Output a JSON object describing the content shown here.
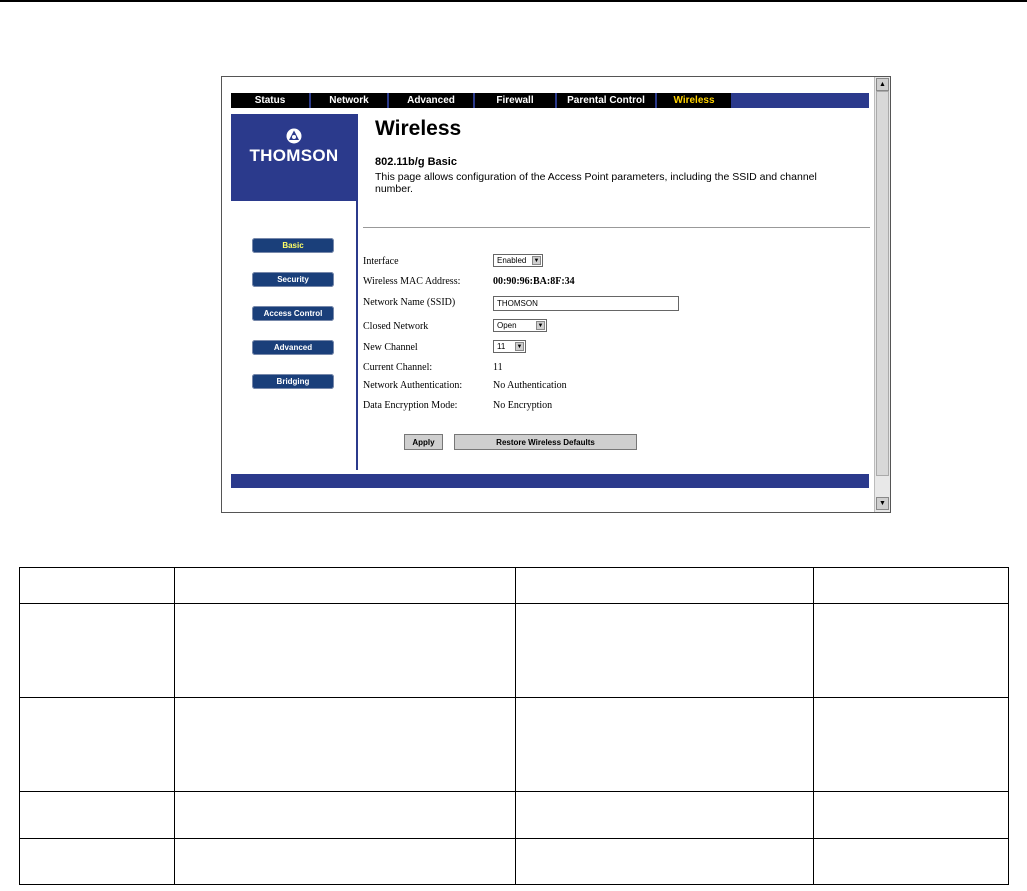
{
  "nav": {
    "tabs": [
      {
        "label": "Status"
      },
      {
        "label": "Network"
      },
      {
        "label": "Advanced"
      },
      {
        "label": "Firewall"
      },
      {
        "label": "Parental Control"
      },
      {
        "label": "Wireless"
      }
    ],
    "active": "Wireless"
  },
  "logo": {
    "text": "THOMSON"
  },
  "sidebar": {
    "buttons": [
      {
        "label": "Basic"
      },
      {
        "label": "Security"
      },
      {
        "label": "Access Control"
      },
      {
        "label": "Advanced"
      },
      {
        "label": "Bridging"
      }
    ],
    "active": "Basic"
  },
  "page": {
    "title": "Wireless",
    "subtitle": "802.11b/g Basic",
    "description": "This page allows configuration of the Access Point parameters, including the SSID and channel number."
  },
  "form": {
    "interface": {
      "label": "Interface",
      "value": "Enabled"
    },
    "mac": {
      "label": "Wireless MAC Address:",
      "value": "00:90:96:BA:8F:34"
    },
    "ssid": {
      "label": "Network Name (SSID)",
      "value": "THOMSON"
    },
    "closed": {
      "label": "Closed Network",
      "value": "Open"
    },
    "channel": {
      "label": "New Channel",
      "value": "11"
    },
    "current_channel": {
      "label": "Current Channel:",
      "value": "11"
    },
    "auth": {
      "label": "Network Authentication:",
      "value": "No Authentication"
    },
    "encryption": {
      "label": "Data Encryption Mode:",
      "value": "No Encryption"
    }
  },
  "buttons": {
    "apply": "Apply",
    "restore": "Restore Wireless Defaults"
  },
  "colors": {
    "brand": "#2b3a8c",
    "active_tab": "#ffd200",
    "active_side": "#ffff66"
  }
}
